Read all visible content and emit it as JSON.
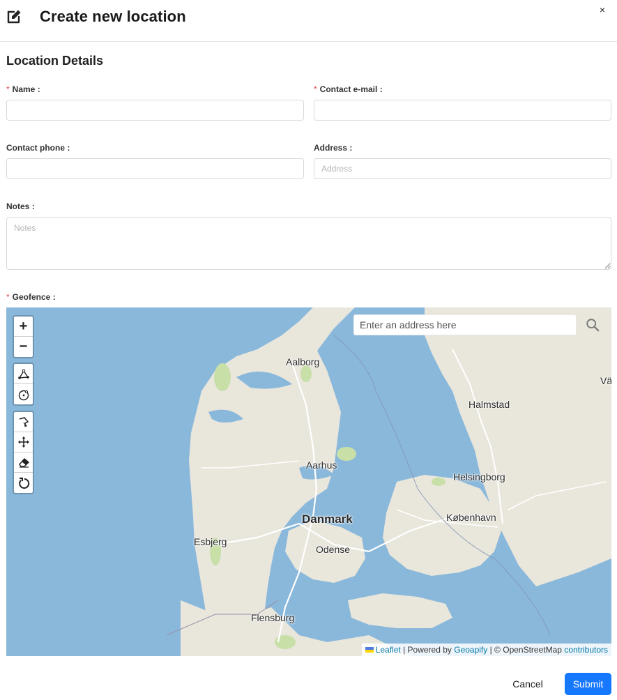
{
  "header": {
    "title": "Create new location",
    "close_label": "×"
  },
  "section_title": "Location Details",
  "form": {
    "name": {
      "label": "Name",
      "colon": ":",
      "value": "",
      "placeholder": ""
    },
    "contact_email": {
      "label": "Contact e-mail",
      "colon": ":",
      "value": "",
      "placeholder": ""
    },
    "contact_phone": {
      "label": "Contact phone",
      "colon": ":",
      "value": "",
      "placeholder": ""
    },
    "address": {
      "label": "Address",
      "colon": ":",
      "value": "",
      "placeholder": "Address"
    },
    "notes": {
      "label": "Notes",
      "colon": ":",
      "value": "",
      "placeholder": "Notes"
    },
    "geofence": {
      "label": "Geofence",
      "colon": ":"
    },
    "required_mark": "*"
  },
  "map": {
    "search_placeholder": "Enter an address here",
    "zoom_in": "+",
    "zoom_out": "−",
    "tools": [
      "draw-polyline-icon",
      "draw-circle-icon",
      "cut-icon",
      "move-icon",
      "eraser-icon",
      "rotate-icon"
    ],
    "labels": {
      "aalborg": "Aalborg",
      "halmstad": "Halmstad",
      "aarhus": "Aarhus",
      "helsingborg": "Helsingborg",
      "denmark": "Danmark",
      "kobenhavn": "København",
      "esbjerg": "Esbjerg",
      "odense": "Odense",
      "flensburg": "Flensburg",
      "edge": "Vä"
    },
    "attribution": {
      "leaflet": "Leaflet",
      "powered_by": "| Powered by",
      "geoapify": "Geoapify",
      "osm": "| © OpenStreetMap",
      "contributors": "contributors"
    },
    "colors": {
      "water": "#8ab8db",
      "land": "#e9e6dc",
      "park": "#c8dfa8"
    }
  },
  "footer": {
    "cancel_label": "Cancel",
    "submit_label": "Submit"
  },
  "colors": {
    "primary": "#1677ff",
    "required": "#e5484d"
  }
}
